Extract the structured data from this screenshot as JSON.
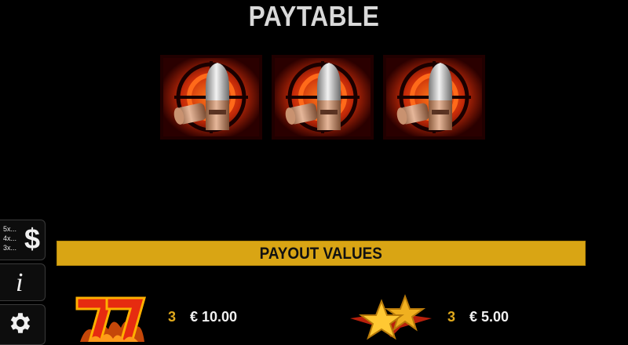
{
  "title": "PAYTABLE",
  "symbols": [
    {
      "name": "bullet-scope-symbol"
    },
    {
      "name": "bullet-scope-symbol"
    },
    {
      "name": "bullet-scope-symbol"
    }
  ],
  "sidebar": {
    "paytable_lines": [
      "5x...",
      "4x...",
      "3x..."
    ],
    "paytable_icon": "$",
    "info_icon": "i",
    "settings_icon": "gear-icon"
  },
  "banner": {
    "label": "PAYOUT VALUES"
  },
  "payouts": [
    {
      "symbol": "seven-icon",
      "count": "3",
      "value": "€ 10.00"
    },
    {
      "symbol": "stars-icon",
      "count": "3",
      "value": "€ 5.00"
    }
  ],
  "colors": {
    "banner": "#d9a514",
    "count_text": "#e0a91c",
    "symbol_red": "#e63b10"
  }
}
